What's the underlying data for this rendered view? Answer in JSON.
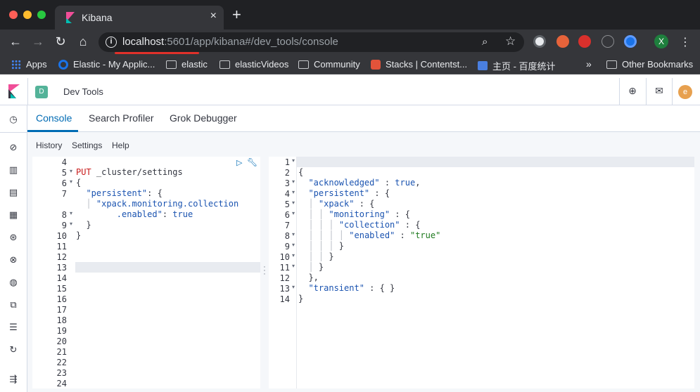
{
  "browser": {
    "tab_title": "Kibana",
    "tab_close": "×",
    "new_tab": "+",
    "url_host": "localhost",
    "url_rest": ":5601/app/kibana#/dev_tools/console",
    "profile_initial": "X",
    "bookmarks": [
      {
        "label": "Apps",
        "icon": "apps-grid-icon"
      },
      {
        "label": "Elastic - My Applic...",
        "icon": "elastic-icon"
      },
      {
        "label": "elastic",
        "icon": "folder-icon"
      },
      {
        "label": "elasticVideos",
        "icon": "folder-icon"
      },
      {
        "label": "Community",
        "icon": "folder-icon"
      },
      {
        "label": "Stacks | Contentst...",
        "icon": "stacks-icon"
      },
      {
        "label": "主页 - 百度统计",
        "icon": "chart-icon"
      }
    ],
    "more_bookmarks": "»",
    "other_bookmarks": "Other Bookmarks"
  },
  "kibana": {
    "space_initial": "D",
    "breadcrumb": "Dev Tools",
    "avatar_initial": "e",
    "tabs": [
      "Console",
      "Search Profiler",
      "Grok Debugger"
    ],
    "subnav": [
      "History",
      "Settings",
      "Help"
    ]
  },
  "request_editor": {
    "line_numbers": [
      "4",
      "5",
      "6",
      "7",
      "",
      "8",
      "9",
      "10",
      "11",
      "12",
      "13",
      "14",
      "15",
      "16",
      "17",
      "18",
      "19",
      "20",
      "21",
      "22",
      "23",
      "24"
    ],
    "active_line": "13"
  },
  "response_editor": {
    "line_numbers": [
      "1",
      "2",
      "3",
      "4",
      "5",
      "6",
      "7",
      "8",
      "9",
      "10",
      "11",
      "12",
      "13",
      "14"
    ]
  },
  "colors": {
    "accent": "#006bb4",
    "method": "#c91b1b",
    "string": "#1a53b0",
    "value": "#1e7a1e"
  }
}
